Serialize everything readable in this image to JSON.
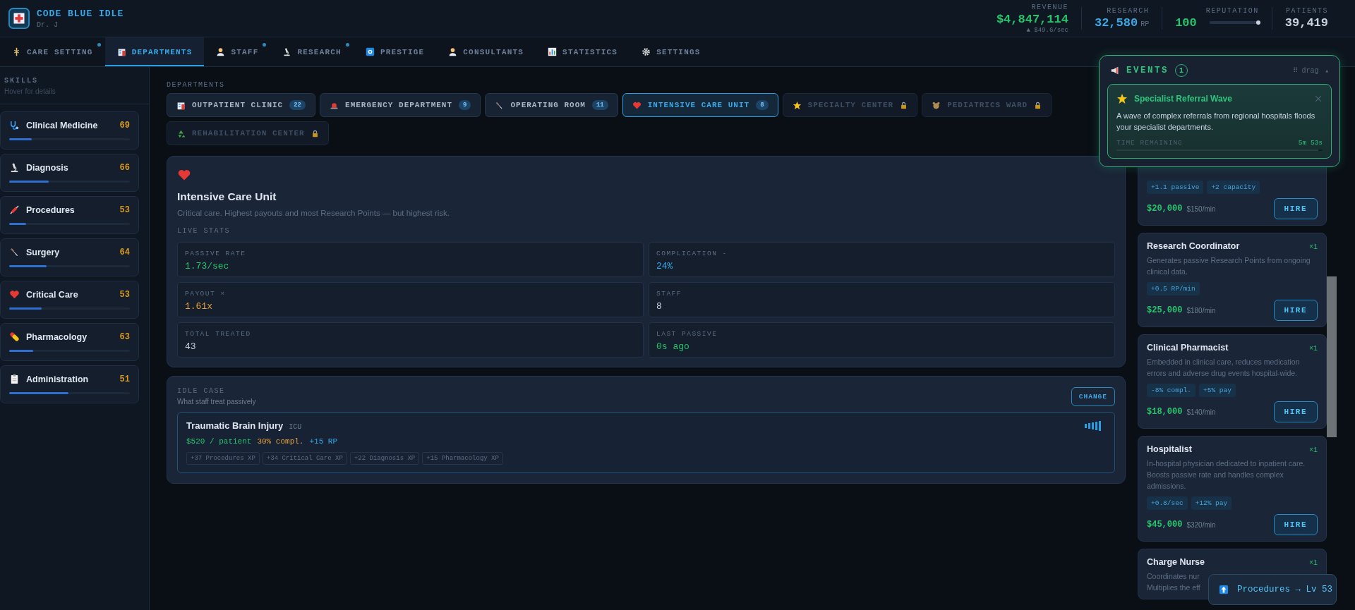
{
  "header": {
    "title": "CODE BLUE IDLE",
    "subtitle": "Dr. J",
    "stats": [
      {
        "label": "REVENUE",
        "value": "$4,847,114",
        "sub": "▲ $49.6/sec",
        "color": "#27c46b"
      },
      {
        "label": "RESEARCH",
        "value": "32,580",
        "unit": "RP",
        "color": "#38a9e6"
      },
      {
        "label": "REPUTATION",
        "value": "100",
        "color": "#27c46b",
        "level": 1
      },
      {
        "label": "PATIENTS",
        "value": "39,419",
        "color": "#c9d3df"
      }
    ]
  },
  "tabs": [
    {
      "label": "CARE SETTING",
      "selected": false,
      "badge": true
    },
    {
      "label": "DEPARTMENTS",
      "selected": true,
      "badge": false
    },
    {
      "label": "STAFF",
      "selected": false,
      "badge": true
    },
    {
      "label": "RESEARCH",
      "selected": false,
      "badge": true
    },
    {
      "label": "PRESTIGE",
      "selected": false,
      "badge": false
    },
    {
      "label": "CONSULTANTS",
      "selected": false,
      "badge": false
    },
    {
      "label": "STATISTICS",
      "selected": false,
      "badge": false
    },
    {
      "label": "SETTINGS",
      "selected": false,
      "badge": false
    }
  ],
  "skills": {
    "title": "SKILLS",
    "hint": "Hover for details",
    "items": [
      {
        "name": "Clinical Medicine",
        "value": "69",
        "level": 0.19
      },
      {
        "name": "Diagnosis",
        "value": "66",
        "level": 0.33
      },
      {
        "name": "Procedures",
        "value": "53",
        "level": 0.14
      },
      {
        "name": "Surgery",
        "value": "64",
        "level": 0.31
      },
      {
        "name": "Critical Care",
        "value": "53",
        "level": 0.27
      },
      {
        "name": "Pharmacology",
        "value": "63",
        "level": 0.2
      },
      {
        "name": "Administration",
        "value": "51",
        "level": 0.49
      }
    ]
  },
  "departments": {
    "label": "DEPARTMENTS",
    "items": [
      {
        "name": "OUTPATIENT CLINIC",
        "count": "22",
        "selected": false,
        "locked": false
      },
      {
        "name": "EMERGENCY DEPARTMENT",
        "count": "9",
        "selected": false,
        "locked": false
      },
      {
        "name": "OPERATING ROOM",
        "count": "11",
        "selected": false,
        "locked": false
      },
      {
        "name": "INTENSIVE CARE UNIT",
        "count": "8",
        "selected": true,
        "locked": false
      },
      {
        "name": "SPECIALTY CENTER",
        "selected": false,
        "locked": true
      },
      {
        "name": "PEDIATRICS WARD",
        "selected": false,
        "locked": true
      },
      {
        "name": "REHABILITATION CENTER",
        "selected": false,
        "locked": true
      }
    ]
  },
  "detail": {
    "title": "Intensive Care Unit",
    "description": "Critical care. Highest payouts and most Research Points — but highest risk.",
    "stats_label": "LIVE STATS",
    "stats": [
      {
        "label": "PASSIVE RATE",
        "value": "1.73/sec",
        "color": "#27c46b"
      },
      {
        "label": "COMPLICATION -",
        "value": "24%",
        "color": "#38a9e6"
      },
      {
        "label": "PAYOUT ×",
        "value": "1.61x",
        "color": "#e6a23c"
      },
      {
        "label": "STAFF",
        "value": "8",
        "color": "#c9d3df"
      },
      {
        "label": "TOTAL TREATED",
        "value": "43",
        "color": "#c9d3df"
      },
      {
        "label": "LAST PASSIVE",
        "value": "0s ago",
        "color": "#27c46b"
      }
    ]
  },
  "idle_case": {
    "label": "IDLE CASE",
    "hint": "What staff treat passively",
    "button": "CHANGE",
    "case": {
      "name": "Traumatic Brain Injury",
      "tag": "ICU",
      "payout": "$520 / patient",
      "complication": "30% compl.",
      "research": "+15 RP",
      "xp": [
        "+37 Procedures XP",
        "+34 Critical Care XP",
        "+22 Diagnosis XP",
        "+15 Pharmacology XP"
      ]
    }
  },
  "staff": [
    {
      "chips": [
        "+1.1 passive",
        "+2 capacity"
      ],
      "price": "$20,000",
      "rate": "$150/min",
      "button": "HIRE"
    },
    {
      "name": "Research Coordinator",
      "count": "×1",
      "description": "Generates passive Research Points from ongoing clinical data.",
      "chips": [
        "+0.5 RP/min"
      ],
      "price": "$25,000",
      "rate": "$180/min",
      "button": "HIRE"
    },
    {
      "name": "Clinical Pharmacist",
      "count": "×1",
      "description": "Embedded in clinical care, reduces medication errors and adverse drug events hospital-wide.",
      "chips": [
        "-8% compl.",
        "+5% pay"
      ],
      "price": "$18,000",
      "rate": "$140/min",
      "button": "HIRE"
    },
    {
      "name": "Hospitalist",
      "count": "×1",
      "description": "In-hospital physician dedicated to inpatient care. Boosts passive rate and handles complex admissions.",
      "chips": [
        "+0.8/sec",
        "+12% pay"
      ],
      "price": "$45,000",
      "rate": "$320/min",
      "button": "HIRE"
    },
    {
      "name": "Charge Nurse",
      "count": "×1",
      "description": "Coordinates nur\nMultiplies the eff"
    }
  ],
  "events": {
    "title": "EVENTS",
    "count": "1",
    "drag": "⠿ drag",
    "toggle": "▴",
    "items": [
      {
        "title": "Specialist Referral Wave",
        "description": "A wave of complex referrals from regional hospitals floods your specialist departments.",
        "timer_label": "TIME REMAINING",
        "timer": "5m 53s",
        "level": 0.98
      }
    ]
  },
  "toast": {
    "text": "Procedures → Lv 53"
  }
}
